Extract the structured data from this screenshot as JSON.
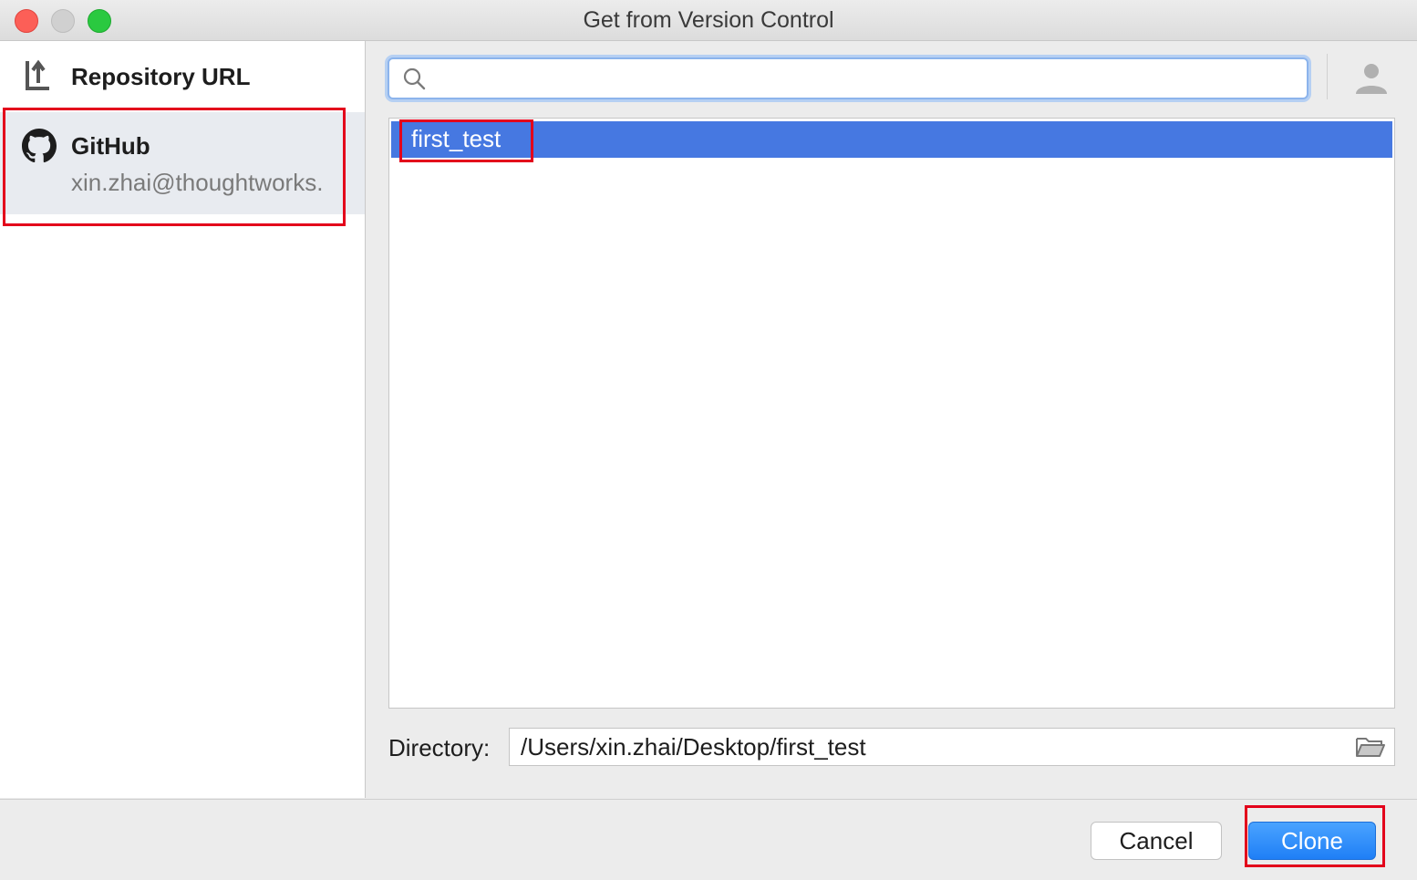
{
  "window": {
    "title": "Get from Version Control"
  },
  "sidebar": {
    "items": [
      {
        "label": "Repository URL",
        "icon": "repository-url-icon"
      },
      {
        "label": "GitHub",
        "subtitle": "xin.zhai@thoughtworks.",
        "icon": "github-icon"
      }
    ]
  },
  "search": {
    "value": "",
    "placeholder": ""
  },
  "repositories": [
    "first_test"
  ],
  "directory": {
    "label": "Directory:",
    "value": "/Users/xin.zhai/Desktop/first_test"
  },
  "footer": {
    "cancel_label": "Cancel",
    "clone_label": "Clone"
  },
  "colors": {
    "selection": "#4678e1",
    "highlight_box": "#e3001b",
    "primary_button": "#1f7ff6"
  }
}
